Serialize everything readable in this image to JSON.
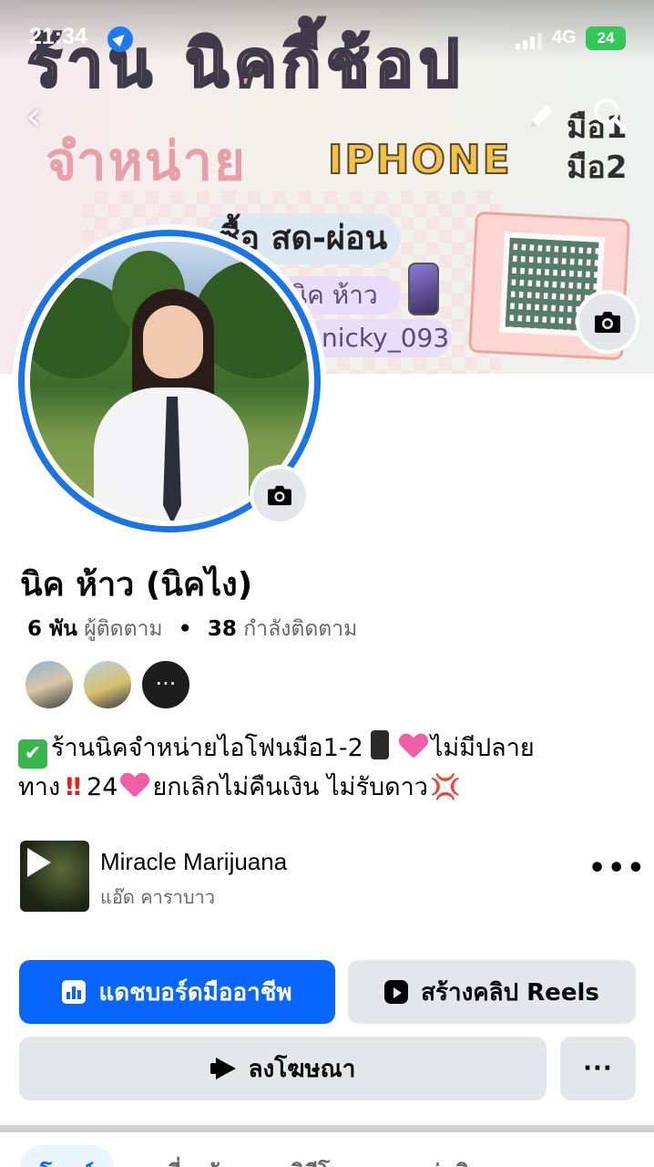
{
  "status_bar": {
    "time": "21:34",
    "network": "4G",
    "battery": "24"
  },
  "cover": {
    "shop_text": "ร้าน นิคกี้ช้อป",
    "sell_text": "จำหน่าย",
    "product_text": "IPHONE",
    "condition_1": "มือ1",
    "condition_2": "มือ2",
    "buy_text": "ซื้อ สด-ผ่อน",
    "name_tag": "นิค ห้าว",
    "line_id": "nicky_093"
  },
  "profile": {
    "name": "นิค ห้าว (นิคไง)",
    "followers_count": "6 พัน",
    "followers_label": "ผู้ติดตาม",
    "following_count": "38",
    "following_label": "กำลังติดตาม",
    "friends_more": "···"
  },
  "bio": {
    "line1_a": "ร้านนิคจำหน่ายไอโฟนมือ1-2",
    "line1_b": "ไม่มีปลาย",
    "line2_a": "ทาง",
    "line2_b": "24",
    "line2_c": "ยกเลิกไม่คืนเงิน ไม่รับดาว",
    "check_mark": "✔",
    "double_bang": "‼",
    "anger_mark": "💢"
  },
  "music": {
    "title": "Miracle Marijuana",
    "artist": "แอ๊ด คาราบาว",
    "more": "•••"
  },
  "actions": {
    "dashboard_label": "แดชบอร์ดมืออาชีพ",
    "reels_label": "สร้างคลิป Reels",
    "ads_label": "ลงโฆษณา",
    "more_label": "···"
  },
  "tabs": [
    {
      "label": "โพสต์"
    },
    {
      "label": "เกี่ยวกับ"
    },
    {
      "label": "วิดีโอ"
    },
    {
      "label": "กลุ่มดิน"
    }
  ],
  "colors": {
    "accent": "#0866ff",
    "avatar_ring": "#1b74e4",
    "secondary_button": "#e4e6eb",
    "muted_text": "#65676b"
  }
}
